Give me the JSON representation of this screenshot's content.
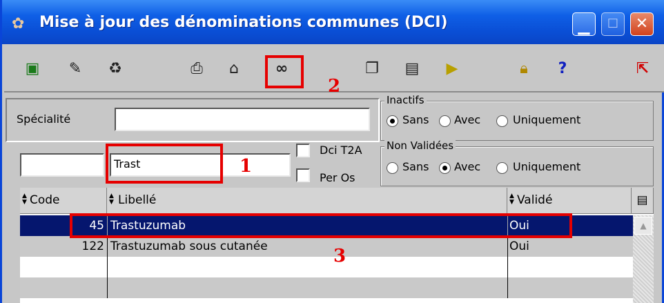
{
  "window": {
    "title": "Mise à jour des dénominations communes (DCI)",
    "title_icon": "app-puzzle-icon",
    "controls": [
      "minimize-icon",
      "maximize-icon",
      "close-icon"
    ]
  },
  "toolbar": {
    "icons": [
      "new-record-icon",
      "edit-record-icon",
      "delete-record-icon",
      "print-icon",
      "properties-icon",
      "binoculars-search-icon",
      "copy-icon",
      "document-icon",
      "export-icon",
      "lock-icon",
      "help-icon",
      "exit-icon"
    ]
  },
  "filters": {
    "specialite_label": "Spécialité",
    "specialite_value": "",
    "code_value": "",
    "search_value": "Trast",
    "dci_t2a_label": "Dci T2A",
    "per_os_label": "Per Os",
    "inactifs": {
      "title": "Inactifs",
      "options": [
        "Sans",
        "Avec",
        "Uniquement"
      ],
      "selected": "Sans"
    },
    "non_validees": {
      "title": "Non Validées",
      "options": [
        "Sans",
        "Avec",
        "Uniquement"
      ],
      "selected": "Avec"
    }
  },
  "annotations": {
    "step1": "1",
    "step2": "2",
    "step3": "3",
    "color": "#e60000"
  },
  "table": {
    "columns": [
      "Code",
      "Libellé",
      "Validé"
    ],
    "rows": [
      {
        "code": "45",
        "libelle": "Trastuzumab",
        "valide": "Oui",
        "selected": true
      },
      {
        "code": "122",
        "libelle": "Trastuzumab sous cutanée",
        "valide": "Oui",
        "selected": false
      }
    ],
    "selection_color": "#05166e"
  }
}
